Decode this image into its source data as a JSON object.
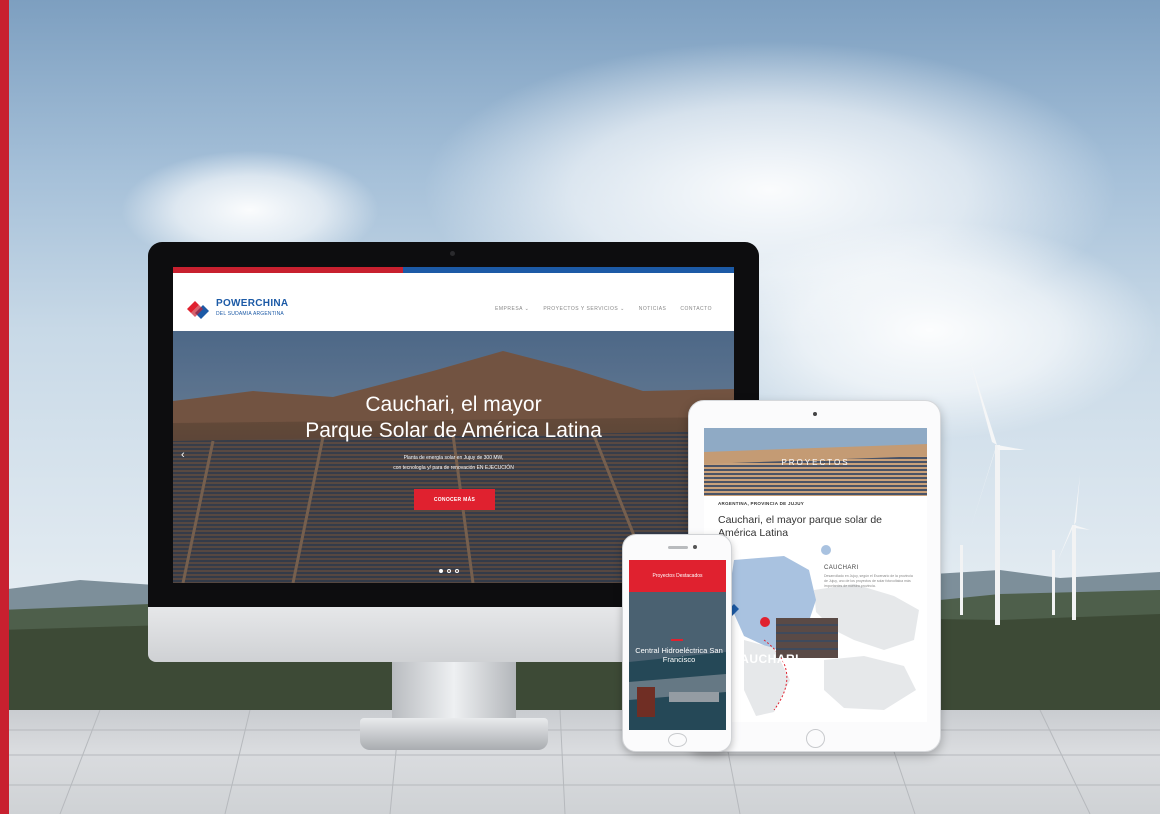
{
  "desktop": {
    "site": {
      "brand": "POWERCHINA",
      "brand_sub": "DEL SUDAMIA ARGENTINA",
      "nav": [
        "EMPRESA ⌄",
        "PROYECTOS Y SERVICIOS ⌄",
        "NOTICIAS",
        "CONTACTO"
      ]
    },
    "hero": {
      "title_line1": "Cauchari, el mayor",
      "title_line2": "Parque Solar de América Latina",
      "sub_line1": "Planta de energía solar en Jujuy de 300 MW,",
      "sub_line2": "con tecnología y/ para de renovación EN EJECUCIÓN",
      "button_label": "CONOCER MÁS",
      "prev_arrow": "‹"
    }
  },
  "tablet": {
    "banner_label": "PROYECTOS",
    "meta": "ARGENTINA, PROVINCIA DE JUJUY",
    "title": "Cauchari, el mayor parque solar de América Latina",
    "map_title": "CAUCHARI",
    "map_body": "Desarrollado en Jujuy, según el Escenario de la provincia de Jujuy, uno de los proyectos de solar fotovoltaica más importantes de nuestra provincia.",
    "map_big_label": "CAUCHARI"
  },
  "phone": {
    "header": "Proyectos Destacados",
    "title": "Central Hidroeléctrica San Francisco"
  },
  "colors": {
    "brand_red": "#e0212f",
    "brand_blue": "#1c5aa6",
    "side_bar": "#c8202f"
  }
}
